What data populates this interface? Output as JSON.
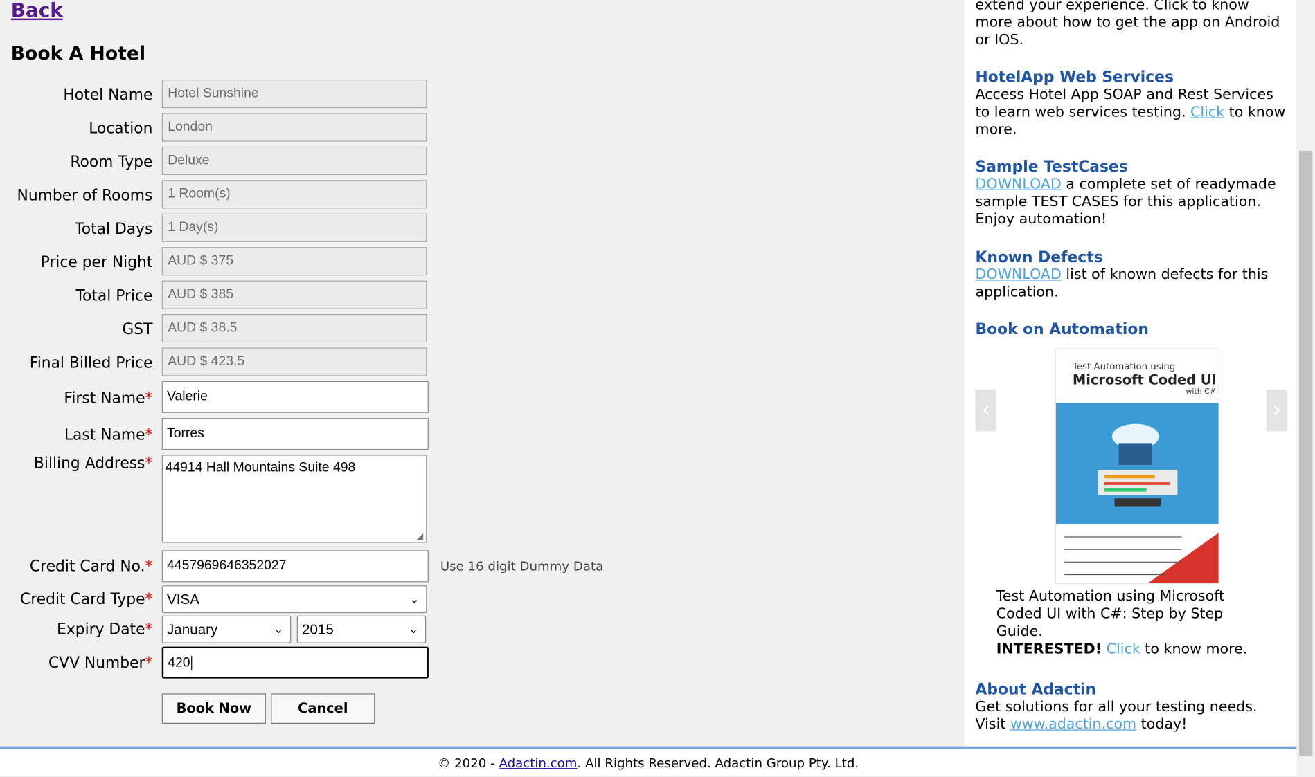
{
  "nav": {
    "back": "Back"
  },
  "form": {
    "title": "Book A Hotel",
    "fields": [
      {
        "label": "Hotel Name",
        "value": "Hotel Sunshine"
      },
      {
        "label": "Location",
        "value": "London"
      },
      {
        "label": "Room Type",
        "value": "Deluxe"
      },
      {
        "label": "Number of Rooms",
        "value": "1 Room(s)"
      },
      {
        "label": "Total Days",
        "value": "1 Day(s)"
      },
      {
        "label": "Price per Night",
        "value": "AUD $ 375"
      },
      {
        "label": "Total Price",
        "value": "AUD $ 385"
      },
      {
        "label": "GST",
        "value": "AUD $ 38.5"
      },
      {
        "label": "Final Billed Price",
        "value": "AUD $ 423.5"
      }
    ],
    "first_name": {
      "label": "First Name",
      "value": "Valerie"
    },
    "last_name": {
      "label": "Last Name",
      "value": "Torres"
    },
    "billing_address": {
      "label": "Billing Address",
      "value": "44914 Hall Mountains Suite 498"
    },
    "credit_card": {
      "label": "Credit Card No.",
      "value": "4457969646352027",
      "hint": "Use 16 digit Dummy Data"
    },
    "card_type": {
      "label": "Credit Card Type",
      "value": "VISA"
    },
    "expiry": {
      "label": "Expiry Date",
      "month": "January",
      "year": "2015"
    },
    "cvv": {
      "label": "CVV Number",
      "value": "420"
    },
    "required_marker": "*",
    "book_now": "Book Now",
    "cancel": "Cancel"
  },
  "sidebar": {
    "intro": "extend your experience. Click to know more about how to get the app on Android or IOS.",
    "web_services": {
      "title": "HotelApp Web Services",
      "text1": "Access Hotel App SOAP and Rest Services to learn web services testing.",
      "link": "Click",
      "text2": "to know more."
    },
    "test_cases": {
      "title": "Sample TestCases",
      "link": "DOWNLOAD",
      "text": "a complete set of readymade sample TEST CASES for this application. Enjoy automation!"
    },
    "known_defects": {
      "title": "Known Defects",
      "link": "DOWNLOAD",
      "text": "list of known defects for this application."
    },
    "book": {
      "title": "Book on Automation",
      "cover_line1": "Test Automation using",
      "cover_line2": "Microsoft Coded UI",
      "cover_line3": "with C#",
      "caption": "Test Automation using Microsoft Coded UI with C#: Step by Step Guide.",
      "interested": "INTERESTED!",
      "link": "Click",
      "tail": "to know more."
    },
    "about": {
      "title": "About Adactin",
      "text1": "Get solutions for all your testing needs.",
      "text2_pre": "Visit",
      "link": "www.adactin.com",
      "text2_post": "today!"
    }
  },
  "footer": {
    "pre": "© 2020 -",
    "link": "Adactin.com",
    "post": ". All Rights Reserved. Adactin Group Pty. Ltd."
  }
}
